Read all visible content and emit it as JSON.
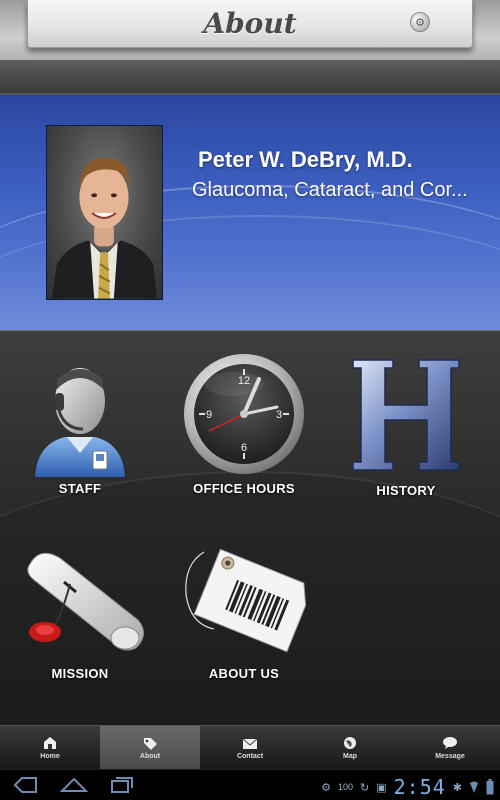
{
  "header": {
    "title": "About",
    "settings_icon": "wrench-icon"
  },
  "profile": {
    "name": "Peter W. DeBry, M.D.",
    "specialty": "Glaucoma, Cataract, and Cor..."
  },
  "grid": {
    "items": [
      {
        "label": "STAFF",
        "icon": "staff-icon"
      },
      {
        "label": "OFFICE HOURS",
        "icon": "clock-icon"
      },
      {
        "label": "HISTORY",
        "icon": "history-h-icon"
      },
      {
        "label": "MISSION",
        "icon": "scroll-seal-icon"
      },
      {
        "label": "ABOUT US",
        "icon": "barcode-tag-icon"
      }
    ]
  },
  "tabs": [
    {
      "label": "Home",
      "icon": "home-icon",
      "active": false
    },
    {
      "label": "About",
      "icon": "tag-icon",
      "active": true
    },
    {
      "label": "Contact",
      "icon": "mail-icon",
      "active": false
    },
    {
      "label": "Map",
      "icon": "globe-icon",
      "active": false
    },
    {
      "label": "Message",
      "icon": "chat-icon",
      "active": false
    }
  ],
  "system": {
    "battery_level": "100",
    "time": "2:54"
  },
  "colors": {
    "profile_blue": "#3d5fc0",
    "grid_dark": "#2a2a2a",
    "clock_blue": "#7fb0de"
  }
}
